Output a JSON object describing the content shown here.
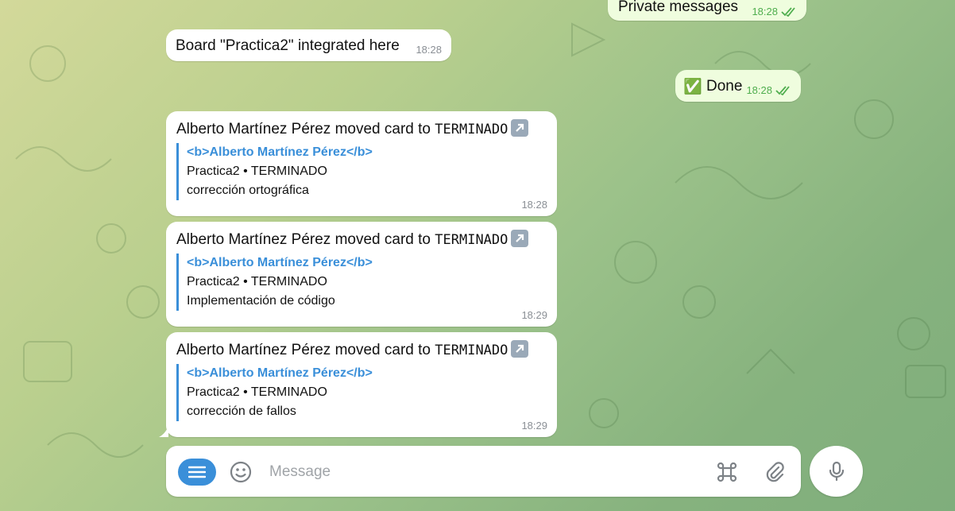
{
  "messages": {
    "private": {
      "text": "Private messages",
      "time": "18:28"
    },
    "board": {
      "text": "Board \"Practica2\" integrated here",
      "time": "18:28"
    },
    "done": {
      "emoji": "✅",
      "text": "Done",
      "time": "18:28"
    },
    "cards": [
      {
        "author": "Alberto Martínez Pérez",
        "action": " moved card to ",
        "list": "TERMINADO",
        "quote_link": "<b>Alberto Martínez Pérez</b>",
        "quote_board": "Practica2 • TERMINADO",
        "quote_card": "corrección ortográfica",
        "time": "18:28"
      },
      {
        "author": "Alberto Martínez Pérez",
        "action": " moved card to ",
        "list": "TERMINADO",
        "quote_link": "<b>Alberto Martínez Pérez</b>",
        "quote_board": "Practica2 • TERMINADO",
        "quote_card": "Implementación de código",
        "time": "18:29"
      },
      {
        "author": "Alberto Martínez Pérez",
        "action": " moved card to ",
        "list": "TERMINADO",
        "quote_link": "<b>Alberto Martínez Pérez</b>",
        "quote_board": "Practica2 • TERMINADO",
        "quote_card": "corrección de fallos",
        "time": "18:29"
      }
    ]
  },
  "composer": {
    "placeholder": "Message",
    "menu_icon": "menu-icon",
    "emoji_icon": "smiley-icon",
    "command_icon": "command-icon",
    "attach_icon": "paperclip-icon",
    "mic_icon": "microphone-icon"
  },
  "colors": {
    "accent": "#3a8fd9",
    "outgoing_bubble": "#effdde",
    "check": "#4fae4e"
  }
}
